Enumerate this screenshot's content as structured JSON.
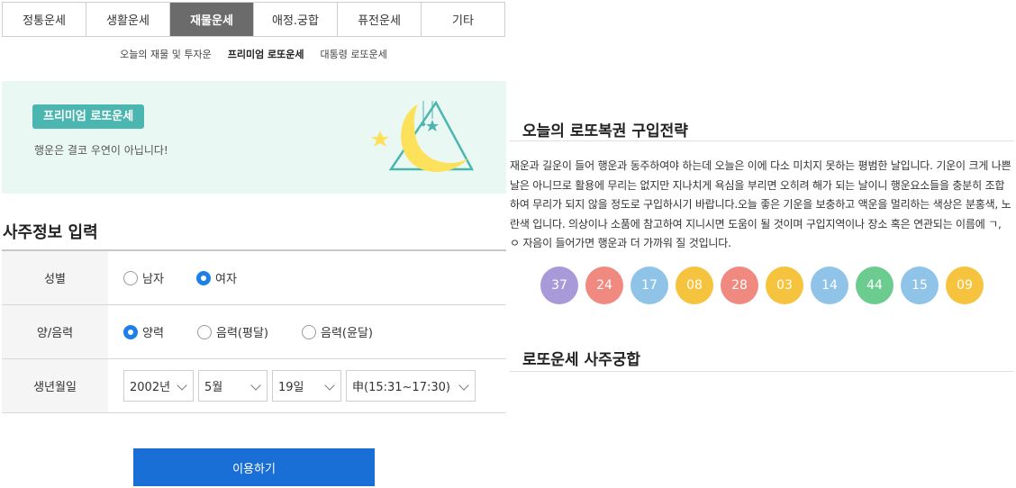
{
  "tabs": [
    {
      "label": "정통운세",
      "active": false
    },
    {
      "label": "생활운세",
      "active": false
    },
    {
      "label": "재물운세",
      "active": true
    },
    {
      "label": "애정.궁합",
      "active": false
    },
    {
      "label": "퓨전운세",
      "active": false
    },
    {
      "label": "기타",
      "active": false
    }
  ],
  "subnav": [
    {
      "label": "오늘의 재물 및 투자운",
      "active": false
    },
    {
      "label": "프리미엄 로또운세",
      "active": true
    },
    {
      "label": "대통령 로또운세",
      "active": false
    }
  ],
  "banner": {
    "badge": "프리미엄 로또운세",
    "text": "행운은 결코 우연이 아닙니다!"
  },
  "form": {
    "title": "사주정보 입력",
    "gender": {
      "label": "성별",
      "options": [
        {
          "label": "남자",
          "selected": false
        },
        {
          "label": "여자",
          "selected": true
        }
      ]
    },
    "calendar": {
      "label": "양/음력",
      "options": [
        {
          "label": "양력",
          "selected": true
        },
        {
          "label": "음력(평달)",
          "selected": false
        },
        {
          "label": "음력(윤달)",
          "selected": false
        }
      ]
    },
    "birth": {
      "label": "생년월일",
      "year": "2002년",
      "month": "5월",
      "day": "19일",
      "time": "申(15:31~17:30)"
    },
    "submit": "이용하기"
  },
  "strategy": {
    "title": "오늘의 로또복권 구입전략",
    "text": "재운과 길운이 들어 행운과 동주하여야 하는데 오늘은 이에 다소 미치지 못하는 평범한 날입니다. 기운이 크게 나쁜 날은 아니므로 활용에 무리는 없지만 지나치게 욕심을 부리면 오히려 해가 되는 날이니 행운요소들을 충분히 조합하여 무리가 되지 않을 정도로 구입하시기 바랍니다.오늘 좋은 기운을 보충하고 액운을 멀리하는 색상은 분홍색, 노란색 입니다. 의상이나 소품에 참고하여 지니시면 도움이 될 것이며 구입지역이나 장소 혹은 연관되는 이름에 ㄱ, ㅇ 자음이 들어가면 행운과 더 가까워 질 것입니다.",
    "numbers": [
      {
        "value": "37",
        "color": "#a89ad8"
      },
      {
        "value": "24",
        "color": "#f08a80"
      },
      {
        "value": "17",
        "color": "#8fc4e8"
      },
      {
        "value": "08",
        "color": "#f6c33f"
      },
      {
        "value": "28",
        "color": "#f08a80"
      },
      {
        "value": "03",
        "color": "#f6c33f"
      },
      {
        "value": "14",
        "color": "#8fc4e8"
      },
      {
        "value": "44",
        "color": "#6ccb8f"
      },
      {
        "value": "15",
        "color": "#8fc4e8"
      },
      {
        "value": "09",
        "color": "#f6c33f"
      }
    ]
  },
  "compat": {
    "title": "로또운세 사주궁합"
  },
  "colors": {
    "accent_teal": "#4bb6b0",
    "primary_blue": "#1a6fd6",
    "radio_blue": "#1e80e6",
    "active_tab": "#6b6b6b"
  },
  "icons": [
    "chevron-down-icon",
    "moon-icon",
    "star-icon",
    "triangle-icon"
  ]
}
